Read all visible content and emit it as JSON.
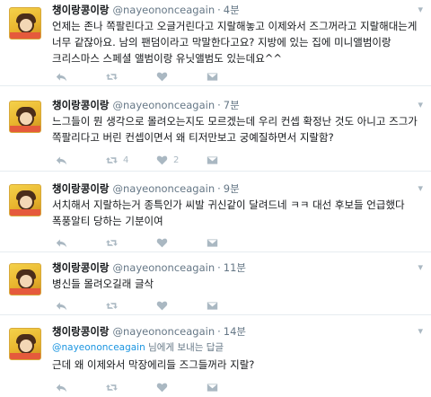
{
  "tweets": [
    {
      "name": "챙이랑콩이랑",
      "handle": "@nayeononceagain",
      "sep": "·",
      "time": "4분",
      "reply_to": null,
      "text": "언제는 존나 쪽팔린다고 오글거린다고 지랄해놓고 이제와서 즈그꺼라고 지랄해대는게 너무 같잖아요. 남의 팬덤이라고 막말한다고요? 지방에 있는 집에 미니앨범이랑 크리스마스 스페셜 앨범이랑 유닛앨범도 있는데요^^",
      "retweets": "",
      "likes": ""
    },
    {
      "name": "챙이랑콩이랑",
      "handle": "@nayeononceagain",
      "sep": "·",
      "time": "7분",
      "reply_to": null,
      "text": "느그들이 뭔 생각으로 몰려오는지도 모르겠는데 우리 컨셉 확정난 것도 아니고 즈그가 쪽팔리다고 버린 컨셉이면서 왜 티저만보고 궁예질하면서 지랄함?",
      "retweets": "4",
      "likes": "2"
    },
    {
      "name": "챙이랑콩이랑",
      "handle": "@nayeononceagain",
      "sep": "·",
      "time": "9분",
      "reply_to": null,
      "text": "서치해서 지랄하는거 종특인가 씨발 귀신같이 달려드네 ㅋㅋ 대선 후보들 언급했다 폭풍알티 당하는 기분이여",
      "retweets": "",
      "likes": ""
    },
    {
      "name": "챙이랑콩이랑",
      "handle": "@nayeononceagain",
      "sep": "·",
      "time": "11분",
      "reply_to": null,
      "text": "병신들 몰려오길래 글삭",
      "retweets": "",
      "likes": ""
    },
    {
      "name": "챙이랑콩이랑",
      "handle": "@nayeononceagain",
      "sep": "·",
      "time": "14분",
      "reply_to": {
        "mention": "@nayeononceagain",
        "suffix": " 님에게 보내는 답글"
      },
      "text": "근데 왜 이제와서 막장에리들 즈그들꺼라 지랄?",
      "retweets": "",
      "likes": ""
    }
  ],
  "icons": {
    "reply": "reply-icon",
    "retweet": "retweet-icon",
    "like": "heart-icon",
    "message": "envelope-icon",
    "menu": "chevron-down-icon"
  },
  "colors": {
    "muted": "#657786",
    "icon": "#aab8c2",
    "link": "#1b95e0",
    "divider": "#e6ecf0"
  }
}
